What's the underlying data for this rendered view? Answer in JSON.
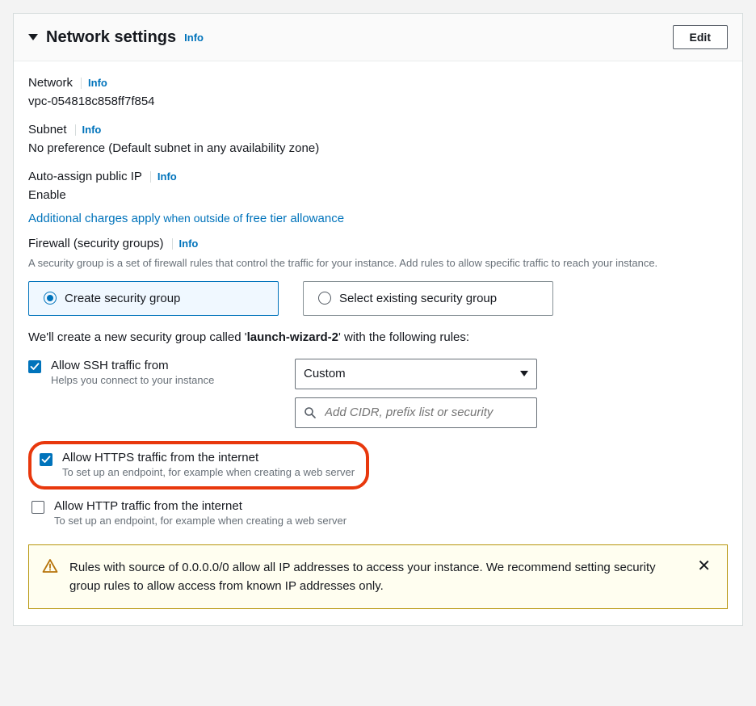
{
  "header": {
    "title": "Network settings",
    "info": "Info",
    "edit": "Edit"
  },
  "network": {
    "label": "Network",
    "info": "Info",
    "value": "vpc-054818c858ff7f854"
  },
  "subnet": {
    "label": "Subnet",
    "info": "Info",
    "value": "No preference (Default subnet in any availability zone)"
  },
  "autoip": {
    "label": "Auto-assign public IP",
    "info": "Info",
    "value": "Enable"
  },
  "charges": {
    "link1": "Additional charges apply",
    "mid": " when outside of ",
    "link2": "free tier allowance"
  },
  "firewall": {
    "label": "Firewall (security groups)",
    "info": "Info",
    "help": "A security group is a set of firewall rules that control the traffic for your instance. Add rules to allow specific traffic to reach your instance."
  },
  "radio": {
    "create": "Create security group",
    "select": "Select existing security group"
  },
  "sg_line": {
    "pre": "We'll create a new security group called '",
    "name": "launch-wizard-2",
    "post": "' with the following rules:"
  },
  "ssh": {
    "label": "Allow SSH traffic from",
    "help": "Helps you connect to your instance",
    "dropdown": "Custom",
    "cidr_placeholder": "Add CIDR, prefix list or security"
  },
  "https": {
    "label": "Allow HTTPS traffic from the internet",
    "help": "To set up an endpoint, for example when creating a web server"
  },
  "http": {
    "label": "Allow HTTP traffic from the internet",
    "help": "To set up an endpoint, for example when creating a web server"
  },
  "alert": {
    "text": "Rules with source of 0.0.0.0/0 allow all IP addresses to access your instance. We recommend setting security group rules to allow access from known IP addresses only."
  }
}
